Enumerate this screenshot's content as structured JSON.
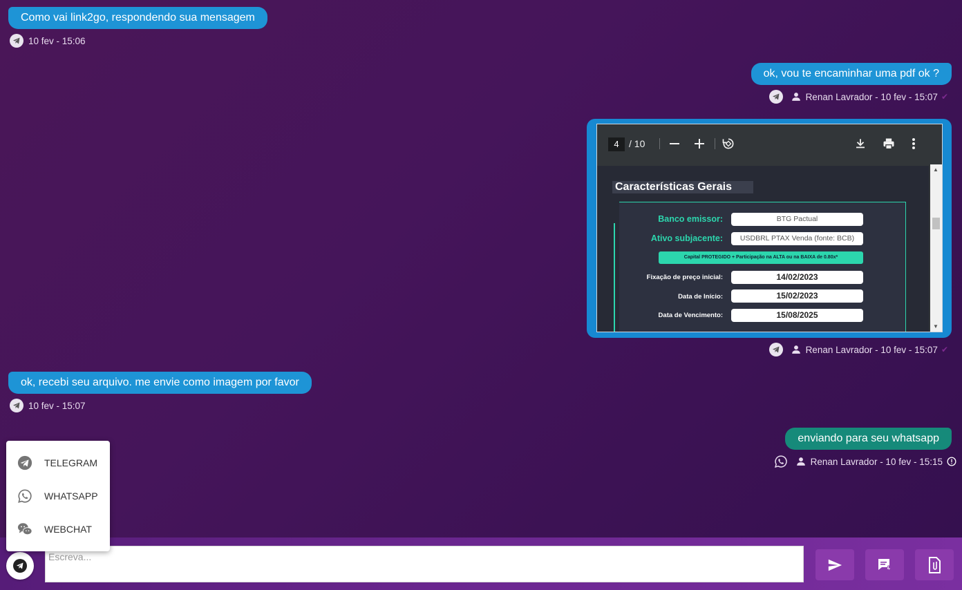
{
  "messages": [
    {
      "text": "Como vai link2go, respondendo sua mensagem",
      "meta": "10 fev - 15:06",
      "channel_icon": "telegram-icon"
    },
    {
      "text": "ok, vou te encaminhar uma pdf ok ?",
      "meta": "Renan Lavrador - 10 fev - 15:07",
      "channel_icon": "telegram-icon"
    },
    {
      "meta": "Renan Lavrador - 10 fev - 15:07",
      "channel_icon": "telegram-icon"
    },
    {
      "text": "ok, recebi seu arquivo. me envie como imagem por favor",
      "meta": "10 fev - 15:07",
      "channel_icon": "telegram-icon"
    },
    {
      "text": "enviando para seu whatsapp",
      "meta": "Renan Lavrador - 10 fev - 15:15",
      "channel_icon": "whatsapp-icon",
      "status_icon": "error-icon"
    }
  ],
  "pdf_viewer": {
    "page": "4",
    "total": "/ 10",
    "slide": {
      "title": "Características Gerais",
      "rows": [
        {
          "label": "Banco emissor:",
          "value": "BTG Pactual"
        },
        {
          "label": "Ativo subjacente:",
          "value": "USDBRL PTAX Venda (fonte: BCB)"
        }
      ],
      "banner": "Capital PROTEGIDO + Participação na ALTA ou na BAIXA de 0.80x*",
      "dates": [
        {
          "label": "Fixação de preço inicial:",
          "value": "14/02/2023"
        },
        {
          "label": "Data de Início:",
          "value": "15/02/2023"
        },
        {
          "label": "Data de Vencimento:",
          "value": "15/08/2025"
        }
      ]
    }
  },
  "channel_menu": {
    "items": [
      {
        "label": "TELEGRAM",
        "icon": "telegram-icon"
      },
      {
        "label": "WHATSAPP",
        "icon": "whatsapp-icon"
      },
      {
        "label": "WEBCHAT",
        "icon": "webchat-icon"
      }
    ]
  },
  "composer": {
    "placeholder": "Escreva...",
    "selected_channel_icon": "telegram-icon"
  },
  "colors": {
    "bubble_blue": "#1e94d6",
    "bubble_green": "#168a7a",
    "accent_purple": "#8a3aab",
    "slide_teal": "#2cd6ad"
  }
}
